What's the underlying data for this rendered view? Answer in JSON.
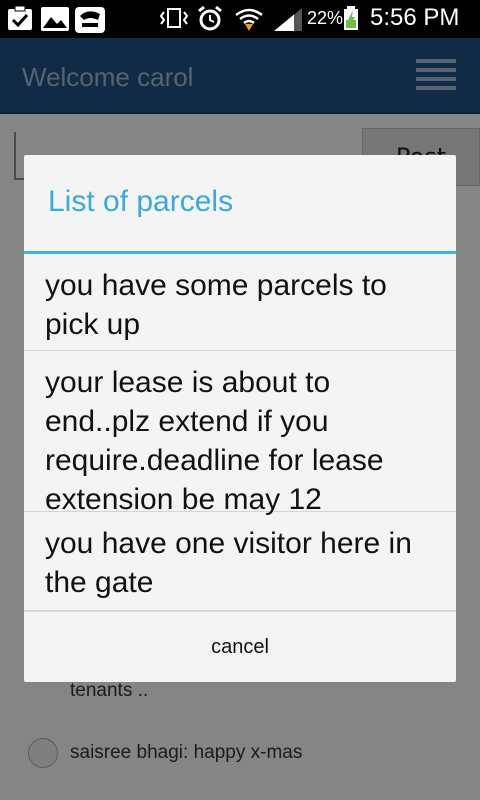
{
  "status_bar": {
    "icons": [
      "clipboard-check-icon",
      "image-icon",
      "app-icon",
      "vibrate-icon",
      "alarm-icon",
      "wifi-icon",
      "signal-icon"
    ],
    "battery": "22%",
    "time": "5:56 PM"
  },
  "app_bar": {
    "title": "Welcome carol",
    "menu_icon": "menu-icon"
  },
  "background": {
    "post_button": "Post",
    "feed": [
      {
        "text": "tenants .."
      },
      {
        "text": "saisree bhagi: happy x-mas"
      }
    ]
  },
  "dialog": {
    "title": "List of parcels",
    "items": [
      {
        "text": "you have some parcels to pick up"
      },
      {
        "text": "your lease is about to end..plz extend if you require.deadline for lease extension be may 12"
      },
      {
        "text": "you have one visitor here in the gate"
      }
    ],
    "cancel": "cancel"
  },
  "colors": {
    "status_bar": "#000000",
    "app_bar": "#1f4e7e",
    "dialog_accent": "#33b5e5"
  }
}
